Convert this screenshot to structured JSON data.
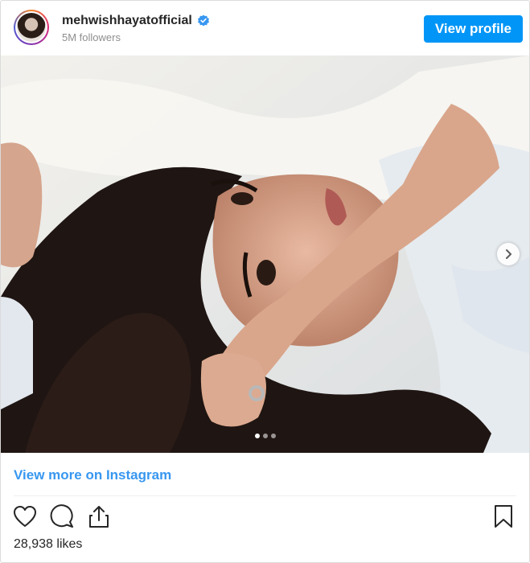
{
  "header": {
    "username": "mehwishhayatofficial",
    "followers": "5M followers",
    "view_profile_label": "View profile",
    "verified_icon": "verified-badge-icon",
    "avatar": "profile-avatar"
  },
  "post": {
    "carousel": {
      "slide_count": 3,
      "active_slide": 1,
      "next_icon": "chevron-right-icon"
    },
    "view_more_label": "View more on Instagram",
    "actions": {
      "like_icon": "heart-icon",
      "comment_icon": "comment-icon",
      "share_icon": "share-icon",
      "save_icon": "bookmark-icon"
    },
    "likes": "28,938 likes"
  },
  "colors": {
    "accent": "#0095f6",
    "link": "#3897f0",
    "text": "#262626",
    "muted": "#8e8e8e"
  }
}
